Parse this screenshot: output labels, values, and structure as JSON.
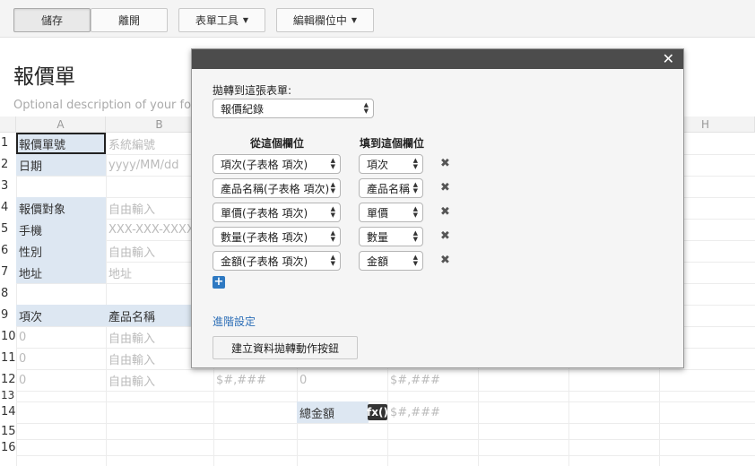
{
  "toolbar": {
    "save": "儲存",
    "leave": "離開",
    "form_tools": "表單工具",
    "editing_field": "編輯欄位中"
  },
  "form": {
    "title": "報價單",
    "description": "Optional description of your form"
  },
  "sheet": {
    "columns": [
      "A",
      "B",
      "H"
    ],
    "rows": [
      "1",
      "2",
      "3",
      "4",
      "5",
      "6",
      "7",
      "8",
      "9",
      "10",
      "11",
      "12",
      "13",
      "14",
      "15",
      "16"
    ],
    "cells": {
      "r1a": "報價單號",
      "r1b": "系統編號",
      "r2a": "日期",
      "r2b": "yyyy/MM/dd",
      "r4a": "報價對象",
      "r4b": "自由輸入",
      "r5a": "手機",
      "r5b": "XXX-XXX-XXXX",
      "r6a": "性別",
      "r6b": "自由輸入",
      "r7a": "地址",
      "r7b": "地址",
      "r9a": "項次",
      "r9b": "產品名稱",
      "r10a": "0",
      "r10b": "自由輸入",
      "r11a": "0",
      "r11b": "自由輸入",
      "r12a": "0",
      "r12b": "自由輸入",
      "r12c": "$#,###",
      "r12d": "0",
      "r12e": "$#,###",
      "r14d": "總金額",
      "r14fx": "fx()",
      "r14e": "$#,###"
    }
  },
  "dialog": {
    "close": "✕",
    "target_label": "拋轉到這張表單:",
    "target_value": "報價紀錄",
    "from_header": "從這個欄位",
    "to_header": "填到這個欄位",
    "mappings": [
      {
        "from": "項次(子表格 項次)",
        "to": "項次"
      },
      {
        "from": "產品名稱(子表格 項次)",
        "to": "產品名稱"
      },
      {
        "from": "單價(子表格 項次)",
        "to": "單價"
      },
      {
        "from": "數量(子表格 項次)",
        "to": "數量"
      },
      {
        "from": "金額(子表格 項次)",
        "to": "金額"
      }
    ],
    "remove_glyph": "✖",
    "add_glyph": "+",
    "advanced": "進階設定",
    "create_button": "建立資料拋轉動作按鈕"
  },
  "colors": {
    "label_bg": "#dde7f2",
    "dialog_bar": "#4c4c4c",
    "add_button": "#2e79c2",
    "link": "#2e6fb7"
  }
}
